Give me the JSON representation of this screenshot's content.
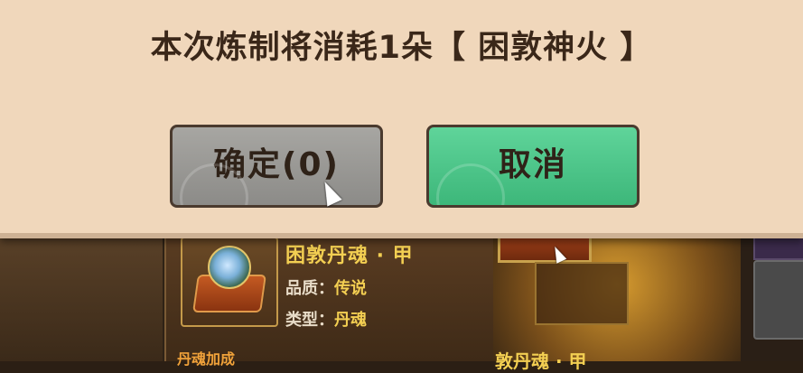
{
  "dialog": {
    "message": "本次炼制将消耗1朵【 困敦神火 】",
    "confirm_label": "确定(0)",
    "cancel_label": "取消"
  },
  "item": {
    "name": "困敦丹魂 · 甲",
    "quality_key": "品质：",
    "quality_value": "传说",
    "type_key": "类型：",
    "type_value": "丹魂",
    "section_header": "丹魂加成",
    "secondary_name": "敦丹魂 · 甲"
  },
  "colors": {
    "dialog_bg": "#f0d7bb",
    "confirm_btn": "#9a9996",
    "cancel_btn": "#4ac388",
    "gold_text": "#f3cf52"
  }
}
